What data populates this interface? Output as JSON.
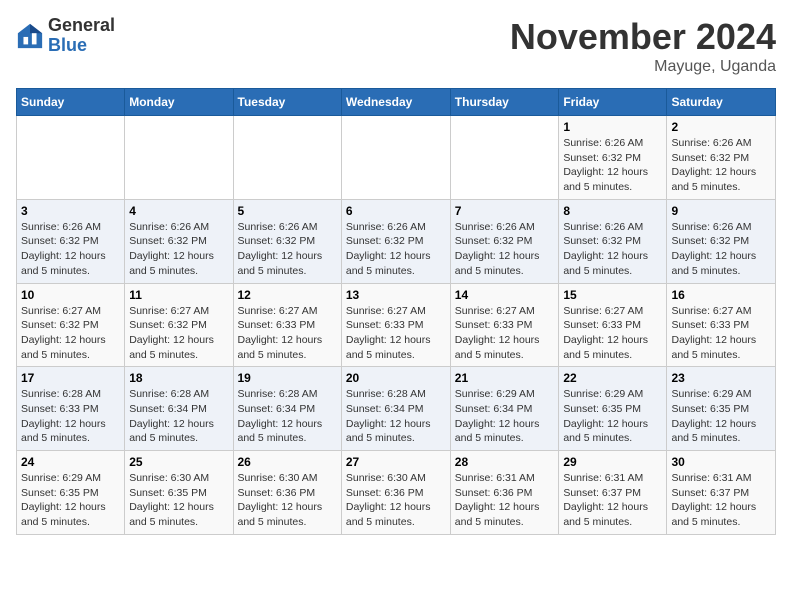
{
  "logo": {
    "general": "General",
    "blue": "Blue"
  },
  "title": "November 2024",
  "subtitle": "Mayuge, Uganda",
  "days_of_week": [
    "Sunday",
    "Monday",
    "Tuesday",
    "Wednesday",
    "Thursday",
    "Friday",
    "Saturday"
  ],
  "weeks": [
    [
      {
        "day": "",
        "info": ""
      },
      {
        "day": "",
        "info": ""
      },
      {
        "day": "",
        "info": ""
      },
      {
        "day": "",
        "info": ""
      },
      {
        "day": "",
        "info": ""
      },
      {
        "day": "1",
        "info": "Sunrise: 6:26 AM\nSunset: 6:32 PM\nDaylight: 12 hours and 5 minutes."
      },
      {
        "day": "2",
        "info": "Sunrise: 6:26 AM\nSunset: 6:32 PM\nDaylight: 12 hours and 5 minutes."
      }
    ],
    [
      {
        "day": "3",
        "info": "Sunrise: 6:26 AM\nSunset: 6:32 PM\nDaylight: 12 hours and 5 minutes."
      },
      {
        "day": "4",
        "info": "Sunrise: 6:26 AM\nSunset: 6:32 PM\nDaylight: 12 hours and 5 minutes."
      },
      {
        "day": "5",
        "info": "Sunrise: 6:26 AM\nSunset: 6:32 PM\nDaylight: 12 hours and 5 minutes."
      },
      {
        "day": "6",
        "info": "Sunrise: 6:26 AM\nSunset: 6:32 PM\nDaylight: 12 hours and 5 minutes."
      },
      {
        "day": "7",
        "info": "Sunrise: 6:26 AM\nSunset: 6:32 PM\nDaylight: 12 hours and 5 minutes."
      },
      {
        "day": "8",
        "info": "Sunrise: 6:26 AM\nSunset: 6:32 PM\nDaylight: 12 hours and 5 minutes."
      },
      {
        "day": "9",
        "info": "Sunrise: 6:26 AM\nSunset: 6:32 PM\nDaylight: 12 hours and 5 minutes."
      }
    ],
    [
      {
        "day": "10",
        "info": "Sunrise: 6:27 AM\nSunset: 6:32 PM\nDaylight: 12 hours and 5 minutes."
      },
      {
        "day": "11",
        "info": "Sunrise: 6:27 AM\nSunset: 6:32 PM\nDaylight: 12 hours and 5 minutes."
      },
      {
        "day": "12",
        "info": "Sunrise: 6:27 AM\nSunset: 6:33 PM\nDaylight: 12 hours and 5 minutes."
      },
      {
        "day": "13",
        "info": "Sunrise: 6:27 AM\nSunset: 6:33 PM\nDaylight: 12 hours and 5 minutes."
      },
      {
        "day": "14",
        "info": "Sunrise: 6:27 AM\nSunset: 6:33 PM\nDaylight: 12 hours and 5 minutes."
      },
      {
        "day": "15",
        "info": "Sunrise: 6:27 AM\nSunset: 6:33 PM\nDaylight: 12 hours and 5 minutes."
      },
      {
        "day": "16",
        "info": "Sunrise: 6:27 AM\nSunset: 6:33 PM\nDaylight: 12 hours and 5 minutes."
      }
    ],
    [
      {
        "day": "17",
        "info": "Sunrise: 6:28 AM\nSunset: 6:33 PM\nDaylight: 12 hours and 5 minutes."
      },
      {
        "day": "18",
        "info": "Sunrise: 6:28 AM\nSunset: 6:34 PM\nDaylight: 12 hours and 5 minutes."
      },
      {
        "day": "19",
        "info": "Sunrise: 6:28 AM\nSunset: 6:34 PM\nDaylight: 12 hours and 5 minutes."
      },
      {
        "day": "20",
        "info": "Sunrise: 6:28 AM\nSunset: 6:34 PM\nDaylight: 12 hours and 5 minutes."
      },
      {
        "day": "21",
        "info": "Sunrise: 6:29 AM\nSunset: 6:34 PM\nDaylight: 12 hours and 5 minutes."
      },
      {
        "day": "22",
        "info": "Sunrise: 6:29 AM\nSunset: 6:35 PM\nDaylight: 12 hours and 5 minutes."
      },
      {
        "day": "23",
        "info": "Sunrise: 6:29 AM\nSunset: 6:35 PM\nDaylight: 12 hours and 5 minutes."
      }
    ],
    [
      {
        "day": "24",
        "info": "Sunrise: 6:29 AM\nSunset: 6:35 PM\nDaylight: 12 hours and 5 minutes."
      },
      {
        "day": "25",
        "info": "Sunrise: 6:30 AM\nSunset: 6:35 PM\nDaylight: 12 hours and 5 minutes."
      },
      {
        "day": "26",
        "info": "Sunrise: 6:30 AM\nSunset: 6:36 PM\nDaylight: 12 hours and 5 minutes."
      },
      {
        "day": "27",
        "info": "Sunrise: 6:30 AM\nSunset: 6:36 PM\nDaylight: 12 hours and 5 minutes."
      },
      {
        "day": "28",
        "info": "Sunrise: 6:31 AM\nSunset: 6:36 PM\nDaylight: 12 hours and 5 minutes."
      },
      {
        "day": "29",
        "info": "Sunrise: 6:31 AM\nSunset: 6:37 PM\nDaylight: 12 hours and 5 minutes."
      },
      {
        "day": "30",
        "info": "Sunrise: 6:31 AM\nSunset: 6:37 PM\nDaylight: 12 hours and 5 minutes."
      }
    ]
  ]
}
